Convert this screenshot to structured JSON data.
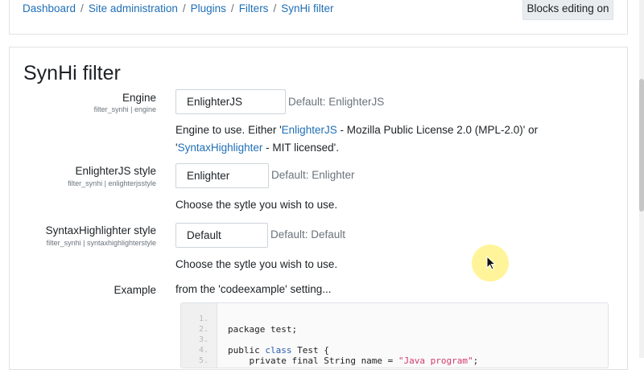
{
  "breadcrumb": {
    "items": [
      "Dashboard",
      "Site administration",
      "Plugins",
      "Filters",
      "SynHi filter"
    ],
    "separator": "/"
  },
  "header": {
    "blocks_editing_label": "Blocks editing on"
  },
  "page": {
    "title": "SynHi filter"
  },
  "settings": {
    "engine": {
      "label": "Engine",
      "sub": "filter_synhi | engine",
      "value": "EnlighterJS",
      "default": "Default: EnlighterJS",
      "desc_before": "Engine to use. Either '",
      "desc_link1": "EnlighterJS",
      "desc_mid": " - Mozilla Public License 2.0 (MPL-2.0)' or '",
      "desc_link2": "SyntaxHighlighter",
      "desc_after": " - MIT licensed'."
    },
    "enlighter_style": {
      "label": "EnlighterJS style",
      "sub": "filter_synhi | enlighterjsstyle",
      "value": "Enlighter",
      "default": "Default: Enlighter",
      "desc": "Choose the sytle you wish to use."
    },
    "syntax_style": {
      "label": "SyntaxHighlighter style",
      "sub": "filter_synhi | syntaxhighlighterstyle",
      "value": "Default",
      "default": "Default: Default",
      "desc": "Choose the sytle you wish to use."
    },
    "example": {
      "label": "Example",
      "desc": "from the 'codeexample' setting..."
    }
  },
  "code": {
    "lines": [
      {
        "num": "1.",
        "text": "package test;"
      },
      {
        "num": "2.",
        "text": ""
      },
      {
        "num": "3.",
        "pre": "public ",
        "kw": "class",
        "post": " Test {"
      },
      {
        "num": "4.",
        "pre": "    private final String name = ",
        "str": "\"Java program\"",
        "post": ";"
      },
      {
        "num": "5.",
        "text": ""
      }
    ]
  },
  "colors": {
    "link": "#1f6fb5",
    "muted": "#6a737b",
    "keyword": "#2a5db0",
    "string": "#d23c6b",
    "cursor_halo": "#fff078"
  }
}
